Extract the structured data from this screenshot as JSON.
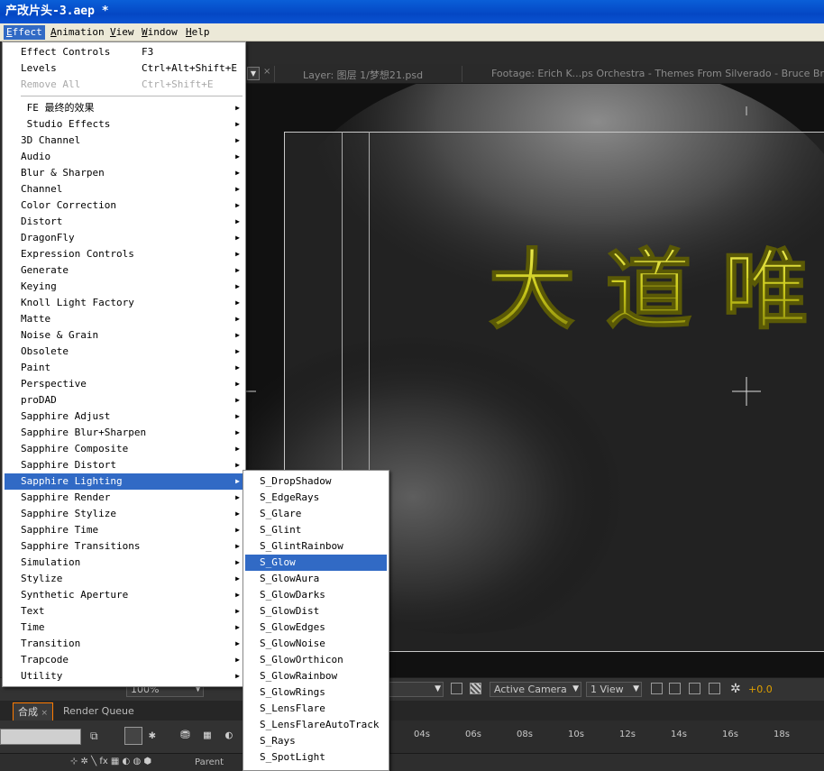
{
  "window": {
    "title": "产改片头-3.aep *"
  },
  "menubar": {
    "items": [
      {
        "label": "Effect",
        "accel": "E",
        "rest": "ffect"
      },
      {
        "label": "Animation",
        "accel": "A",
        "rest": "nimation"
      },
      {
        "label": "View",
        "accel": "V",
        "rest": "iew"
      },
      {
        "label": "Window",
        "accel": "W",
        "rest": "indow"
      },
      {
        "label": "Help",
        "accel": "H",
        "rest": "elp"
      }
    ]
  },
  "panels": {
    "tabs": [
      "Layer: 图层 1/梦想21.psd",
      "Footage: Erich K...ps Orchestra - Themes From Silverado - Bruce Brough"
    ]
  },
  "viewer": {
    "title_text": "大 道 唯"
  },
  "viewer_controls": {
    "zoom": "100%",
    "camera": "Active Camera",
    "views": "1 View",
    "exposure": "+0.0"
  },
  "timeline": {
    "tabs": [
      "合成",
      "Render Queue"
    ],
    "ruler": [
      "04s",
      "06s",
      "08s",
      "10s",
      "12s",
      "14s",
      "16s",
      "18s"
    ],
    "parent_label": "Parent"
  },
  "effect_menu": {
    "top_items": [
      {
        "label": "Effect Controls",
        "shortcut": "F3",
        "disabled": false
      },
      {
        "label": "Levels",
        "shortcut": "Ctrl+Alt+Shift+E",
        "disabled": false
      },
      {
        "label": "Remove All",
        "shortcut": "Ctrl+Shift+E",
        "disabled": true
      }
    ],
    "categories": [
      " FE 最终的效果",
      " Studio Effects",
      "3D Channel",
      "Audio",
      "Blur & Sharpen",
      "Channel",
      "Color Correction",
      "Distort",
      "DragonFly",
      "Expression Controls",
      "Generate",
      "Keying",
      "Knoll Light Factory",
      "Matte",
      "Noise & Grain",
      "Obsolete",
      "Paint",
      "Perspective",
      "proDAD",
      "Sapphire Adjust",
      "Sapphire Blur+Sharpen",
      "Sapphire Composite",
      "Sapphire Distort",
      "Sapphire Lighting",
      "Sapphire Render",
      "Sapphire Stylize",
      "Sapphire Time",
      "Sapphire Transitions",
      "Simulation",
      "Stylize",
      "Synthetic Aperture",
      "Text",
      "Time",
      "Transition",
      "Trapcode",
      "Utility"
    ],
    "highlighted_category": "Sapphire Lighting"
  },
  "lighting_submenu": {
    "items": [
      "S_DropShadow",
      "S_EdgeRays",
      "S_Glare",
      "S_Glint",
      "S_GlintRainbow",
      "S_Glow",
      "S_GlowAura",
      "S_GlowDarks",
      "S_GlowDist",
      "S_GlowEdges",
      "S_GlowNoise",
      "S_GlowOrthicon",
      "S_GlowRainbow",
      "S_GlowRings",
      "S_LensFlare",
      "S_LensFlareAutoTrack",
      "S_Rays",
      "S_SpotLight"
    ],
    "highlighted": "S_Glow"
  },
  "colors": {
    "title_bar": "#0a53d2",
    "menu_highlight": "#316ac5",
    "text_gold": "#d6d51c",
    "accent_orange": "#ff7b00"
  }
}
